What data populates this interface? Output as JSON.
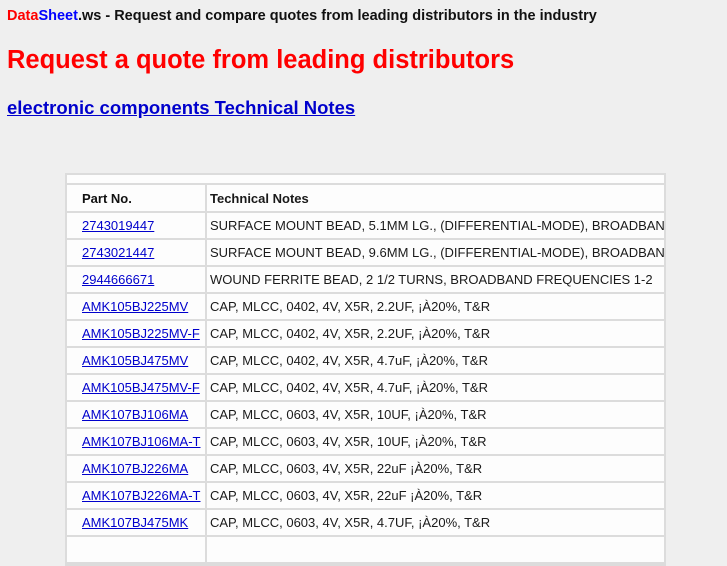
{
  "header": {
    "brand_data": "Data",
    "brand_sheet": "Sheet",
    "brand_suffix": ".ws",
    "tagline": " - Request and compare quotes from leading distributors in the industry"
  },
  "headline": "Request a quote from leading distributors",
  "subhead_link": "electronic components Technical Notes",
  "table": {
    "columns": [
      "Part No.",
      "Technical Notes"
    ],
    "rows": [
      {
        "part": "2743019447",
        "note": "SURFACE MOUNT BEAD, 5.1MM LG., (DIFFERENTIAL-MODE), BROADBAN"
      },
      {
        "part": "2743021447",
        "note": "SURFACE MOUNT BEAD, 9.6MM LG., (DIFFERENTIAL-MODE), BROADBAN"
      },
      {
        "part": "2944666671",
        "note": "WOUND FERRITE BEAD, 2 1/2 TURNS, BROADBAND FREQUENCIES 1-2"
      },
      {
        "part": "AMK105BJ225MV",
        "note": "CAP, MLCC, 0402, 4V, X5R, 2.2UF, ¡À20%, T&R"
      },
      {
        "part": "AMK105BJ225MV-F",
        "note": "CAP, MLCC, 0402, 4V, X5R, 2.2UF, ¡À20%, T&R"
      },
      {
        "part": "AMK105BJ475MV",
        "note": "CAP, MLCC, 0402, 4V, X5R, 4.7uF, ¡À20%, T&R"
      },
      {
        "part": "AMK105BJ475MV-F",
        "note": "CAP, MLCC, 0402, 4V, X5R, 4.7uF, ¡À20%, T&R"
      },
      {
        "part": "AMK107BJ106MA",
        "note": "CAP, MLCC, 0603, 4V, X5R, 10UF, ¡À20%, T&R"
      },
      {
        "part": "AMK107BJ106MA-T",
        "note": "CAP, MLCC, 0603, 4V, X5R, 10UF, ¡À20%, T&R"
      },
      {
        "part": "AMK107BJ226MA",
        "note": "CAP, MLCC, 0603, 4V, X5R, 22uF ¡À20%, T&R"
      },
      {
        "part": "AMK107BJ226MA-T",
        "note": "CAP, MLCC, 0603, 4V, X5R, 22uF ¡À20%, T&R"
      },
      {
        "part": "AMK107BJ475MK",
        "note": "CAP, MLCC, 0603, 4V, X5R, 4.7UF, ¡À20%, T&R"
      },
      {
        "part": "",
        "note": ""
      }
    ]
  },
  "colors": {
    "brand_red": "#ff0000",
    "brand_blue": "#0000ff",
    "link": "#0000cc",
    "background": "#efefef"
  }
}
